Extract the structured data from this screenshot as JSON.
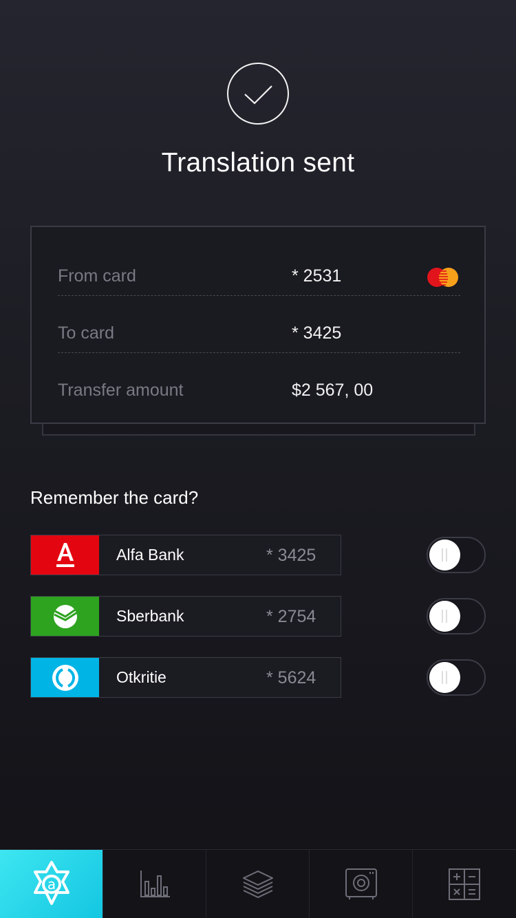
{
  "header": {
    "status_icon": "checkmark-circle-icon",
    "title": "Translation sent"
  },
  "transfer": {
    "from": {
      "label": "From card",
      "value": "* 2531",
      "icon": "mastercard-icon"
    },
    "to": {
      "label": "To card",
      "value": "* 3425"
    },
    "amount": {
      "label": "Transfer amount",
      "value": "$2 567, 00"
    }
  },
  "remember": {
    "title": "Remember the card?",
    "cards": [
      {
        "bank": "Alfa Bank",
        "number": "* 3425",
        "color": "#e30611",
        "icon": "alfa-bank-logo",
        "remember": false
      },
      {
        "bank": "Sberbank",
        "number": "* 2754",
        "color": "#21a038",
        "icon": "sberbank-logo",
        "remember": false
      },
      {
        "bank": "Otkritie",
        "number": "* 5624",
        "color": "#00b4e6",
        "icon": "otkritie-logo",
        "remember": false
      }
    ]
  },
  "tabbar": {
    "tabs": [
      {
        "name": "home",
        "icon": "app-logo-icon",
        "active": true
      },
      {
        "name": "statistics",
        "icon": "bar-chart-icon",
        "active": false
      },
      {
        "name": "cards",
        "icon": "layers-icon",
        "active": false
      },
      {
        "name": "safe",
        "icon": "safe-icon",
        "active": false
      },
      {
        "name": "calculator",
        "icon": "calculator-icon",
        "active": false
      }
    ],
    "accent": "#1fd0e6"
  },
  "colors": {
    "background": "#1c1c23",
    "muted_text": "#7a7a84",
    "border": "#3b3b45"
  }
}
